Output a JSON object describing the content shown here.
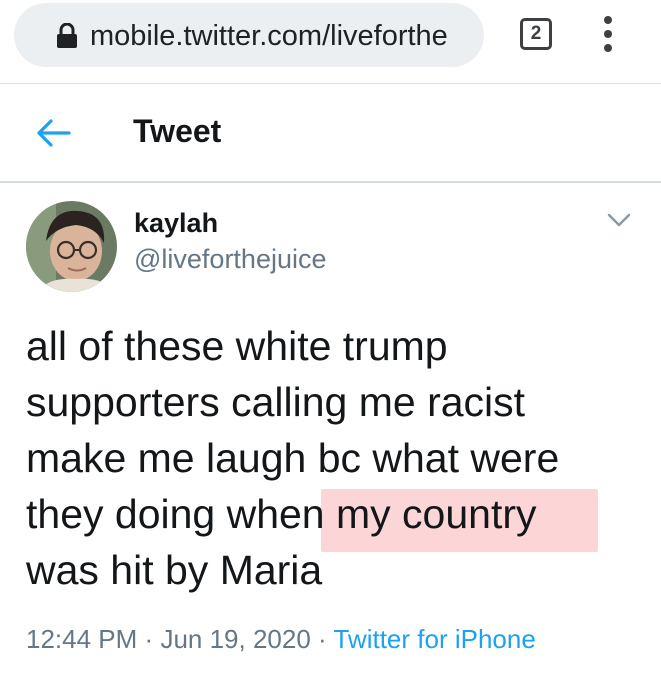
{
  "browser": {
    "url": "mobile.twitter.com/liveforthe",
    "tab_count": "2"
  },
  "header": {
    "title": "Tweet"
  },
  "tweet": {
    "display_name": "kaylah",
    "handle": "@liveforthejuice",
    "text_lines": [
      "all of these white trump",
      "supporters calling me racist",
      "make me laugh bc what were",
      "they doing when my country",
      "was hit by Maria"
    ],
    "time": "12:44 PM",
    "date": "Jun 19, 2020",
    "separator": "·",
    "source": "Twitter for iPhone"
  },
  "colors": {
    "accent": "#1da1f2",
    "secondary_text": "#657786",
    "highlight": "#fab4b4"
  }
}
